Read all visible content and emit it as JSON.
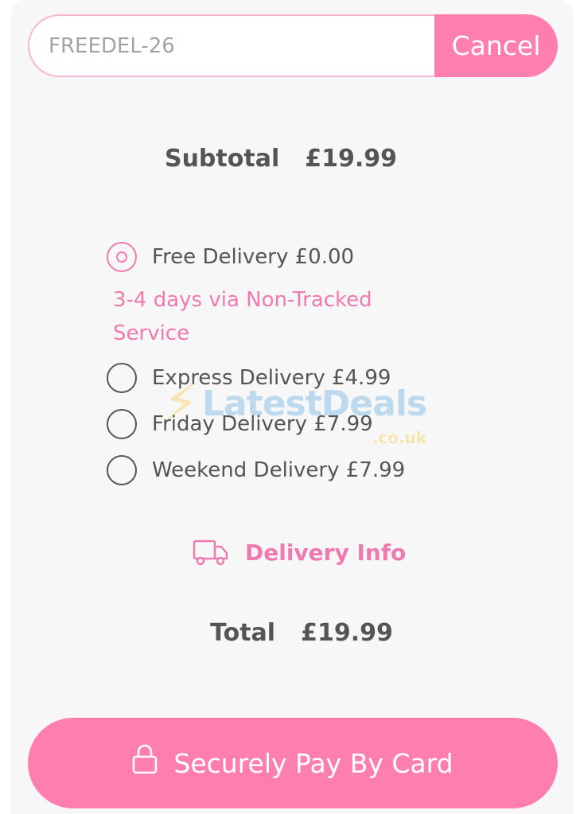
{
  "coupon": {
    "value": "FREEDEL-26",
    "cancel_label": "Cancel"
  },
  "subtotal": {
    "label": "Subtotal",
    "amount": "£19.99"
  },
  "delivery": {
    "options": [
      {
        "label": "Free Delivery £0.00",
        "selected": true,
        "note": "3-4 days via Non-Tracked Service"
      },
      {
        "label": "Express Delivery £4.99",
        "selected": false
      },
      {
        "label": "Friday Delivery £7.99",
        "selected": false
      },
      {
        "label": "Weekend Delivery £7.99",
        "selected": false
      }
    ],
    "info_label": "Delivery Info",
    "info_icon": "truck-icon"
  },
  "watermark": {
    "text": "LatestDeals",
    "suffix": ".co.uk"
  },
  "total": {
    "label": "Total",
    "amount": "£19.99"
  },
  "pay": {
    "label": "Securely Pay By Card",
    "icon": "lock-icon"
  },
  "colors": {
    "accent": "#ff7eb0",
    "accent_text": "#f07ab0",
    "text": "#555555",
    "panel": "#f7f7f7"
  }
}
